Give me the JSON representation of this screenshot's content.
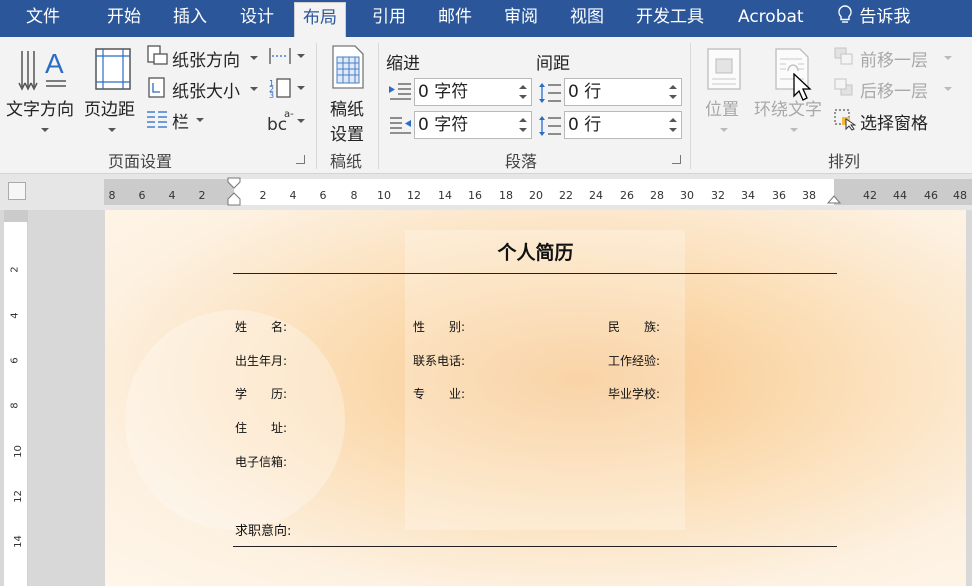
{
  "tabs": [
    {
      "label": "文件"
    },
    {
      "label": "开始"
    },
    {
      "label": "插入"
    },
    {
      "label": "设计"
    },
    {
      "label": "布局",
      "active": true
    },
    {
      "label": "引用"
    },
    {
      "label": "邮件"
    },
    {
      "label": "审阅"
    },
    {
      "label": "视图"
    },
    {
      "label": "开发工具"
    },
    {
      "label": "Acrobat"
    }
  ],
  "tell_me": {
    "icon": "lightbulb-icon",
    "label": "告诉我"
  },
  "page_setup": {
    "text_direction": "文字方向",
    "margins": "页边距",
    "orientation": "纸张方向",
    "size": "纸张大小",
    "columns": "栏",
    "group_label": "页面设置"
  },
  "draft": {
    "label_1": "稿纸",
    "label_2": "设置",
    "group_label": "稿纸"
  },
  "paragraph": {
    "indent_label": "缩进",
    "spacing_label": "间距",
    "indent_left": "0 字符",
    "indent_right": "0 字符",
    "spacing_before": "0 行",
    "spacing_after": "0 行",
    "group_label": "段落"
  },
  "arrange": {
    "position": "位置",
    "wrap_text": "环绕文字",
    "bring_forward": "前移一层",
    "send_backward": "后移一层",
    "selection_pane": "选择窗格",
    "group_label": "排列"
  },
  "ruler": {
    "left_ticks": [
      "8",
      "6",
      "4",
      "2"
    ],
    "right_ticks": [
      "2",
      "4",
      "6",
      "8",
      "10",
      "12",
      "14",
      "16",
      "18",
      "20",
      "22",
      "24",
      "26",
      "28",
      "30",
      "32",
      "34",
      "36",
      "38",
      "42",
      "44",
      "46",
      "48"
    ],
    "vertical_ticks": [
      "2",
      "4",
      "6",
      "8",
      "10",
      "12",
      "14"
    ]
  },
  "document": {
    "title": "个人简历",
    "fields": {
      "name": "姓　　名:",
      "gender": "性　　别:",
      "ethnicity": "民　　族:",
      "birth": "出生年月:",
      "phone": "联系电话:",
      "experience": "工作经验:",
      "education": "学　　历:",
      "major": "专　　业:",
      "school": "毕业学校:",
      "address": "住　　址:",
      "email": "电子信箱:",
      "objective": "求职意向:"
    }
  },
  "colors": {
    "tab_bar": "#2b579a",
    "ribbon": "#f3f3f3",
    "page_warm": "#f8c58a"
  }
}
